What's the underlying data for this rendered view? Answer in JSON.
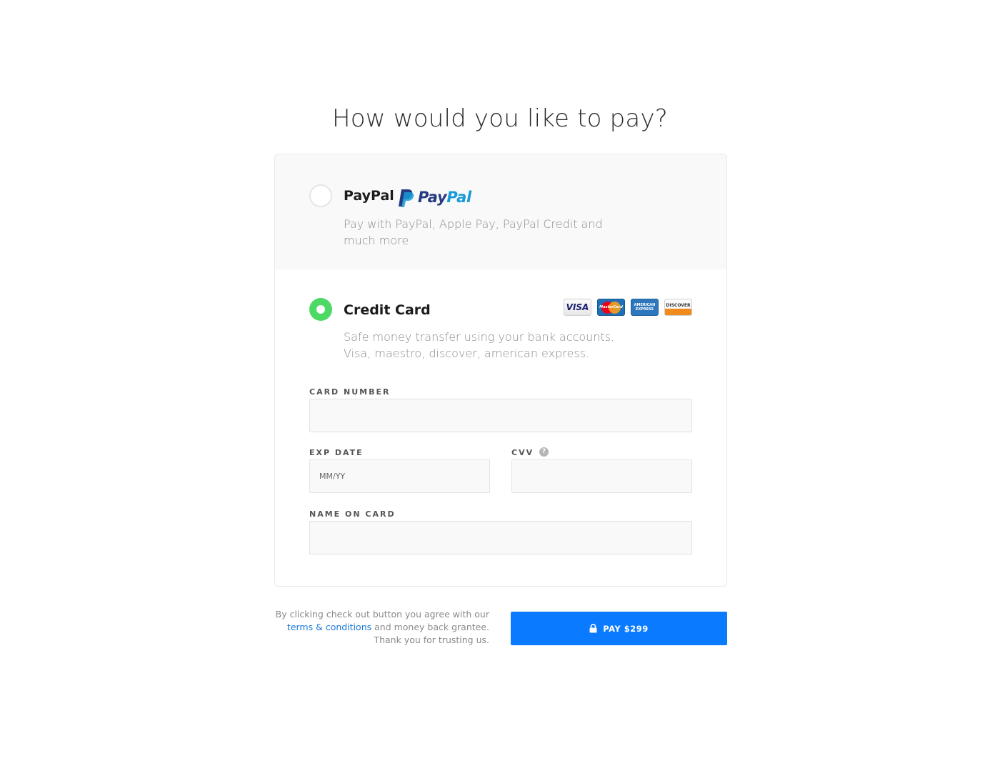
{
  "page": {
    "title": "How would you like to pay?"
  },
  "paypal": {
    "label": "PayPal",
    "logo_text_pay": "Pay",
    "logo_text_pal": "Pal",
    "description": "Pay with PayPal, Apple Pay, PayPal Credit and much more",
    "selected": false
  },
  "credit_card": {
    "label": "Credit Card",
    "description_line1": "Safe money transfer using your bank accounts.",
    "description_line2": "Visa, maestro, discover, american express.",
    "selected": true,
    "accepted_cards": [
      "visa-icon",
      "mastercard-icon",
      "amex-icon",
      "discover-icon"
    ],
    "card_texts": {
      "visa": "VISA",
      "mastercard": "MasterCard",
      "amex": "AMERICAN EXPRESS",
      "discover": "DISCOVER"
    }
  },
  "form": {
    "card_number_label": "CARD NUMBER",
    "card_number_value": "",
    "exp_date_label": "EXP DATE",
    "exp_date_placeholder": "MM/YY",
    "exp_date_value": "",
    "cvv_label": "CVV",
    "cvv_help": "?",
    "cvv_value": "",
    "name_label": "NAME ON CARD",
    "name_value": ""
  },
  "footer": {
    "terms_before": "By clicking check out button you agree with our",
    "terms_link": "terms & conditions",
    "terms_after": "and money back grantee.",
    "terms_thanks": "Thank you for trusting us.",
    "pay_button_label": "PAY $299"
  },
  "colors": {
    "accent": "#0a7aff",
    "selected_radio": "#4cd964",
    "link": "#1a7ad9"
  }
}
